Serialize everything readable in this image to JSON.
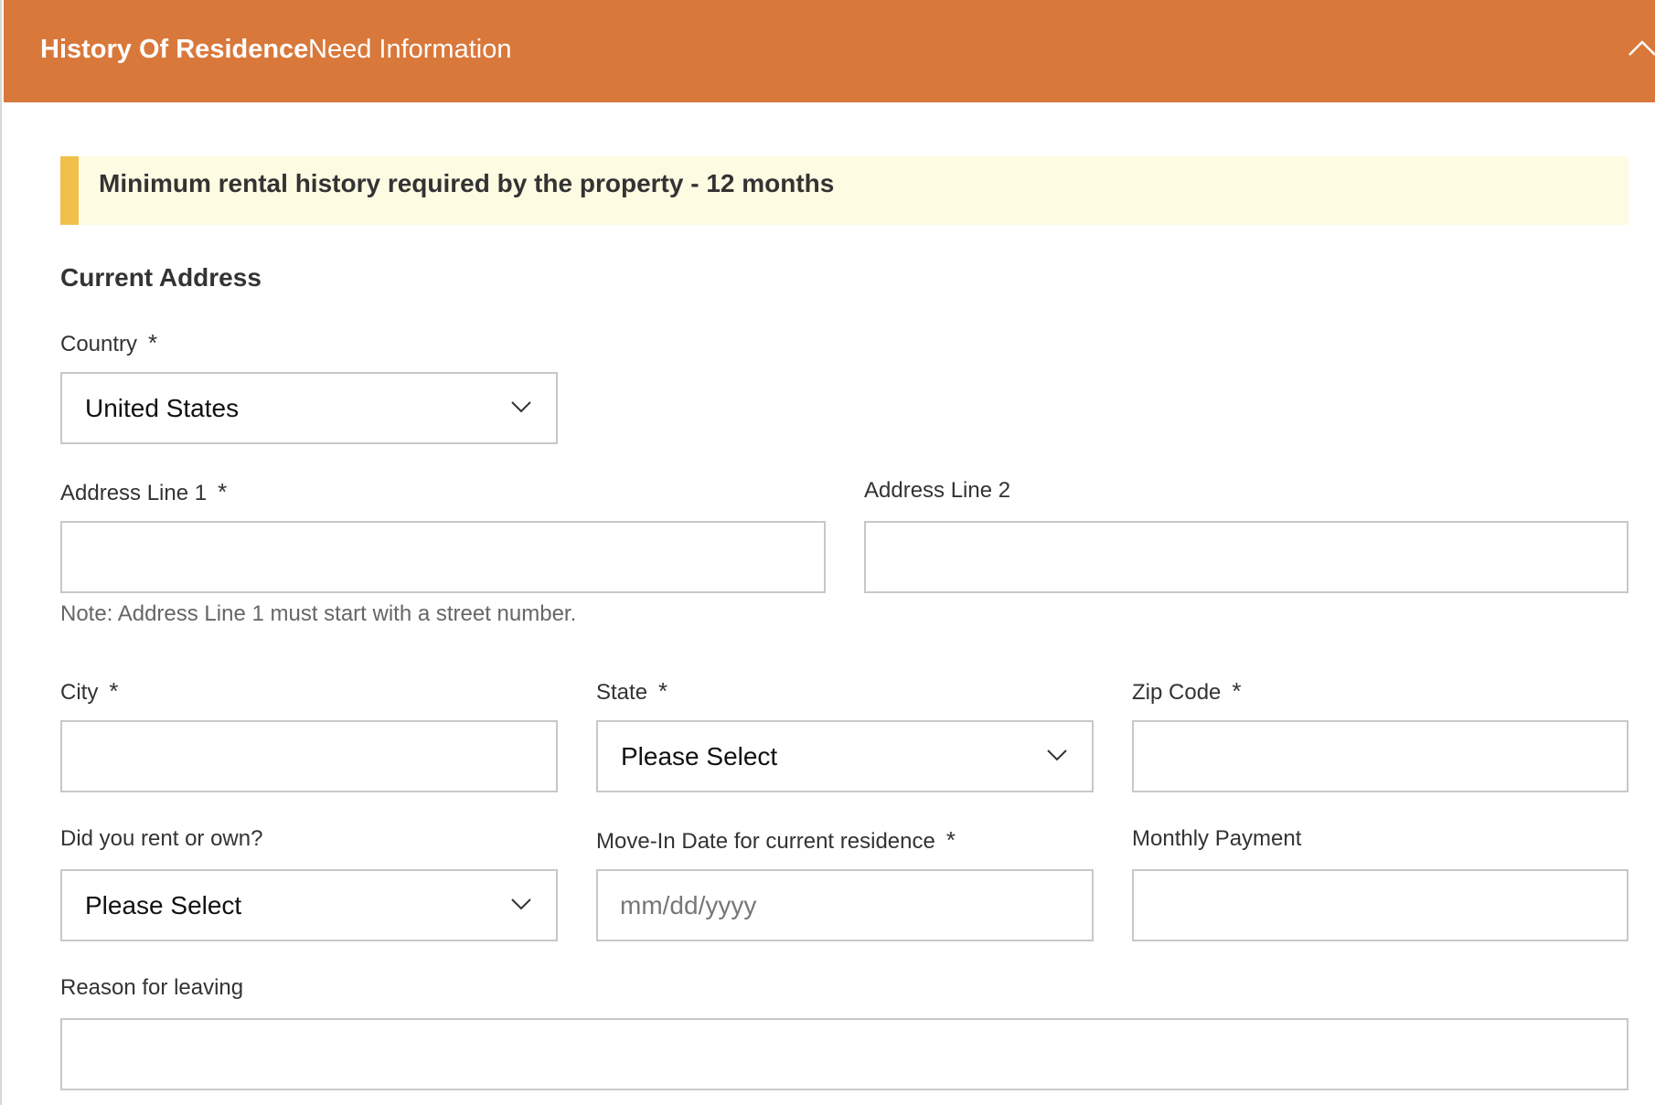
{
  "header": {
    "title": "History Of Residence",
    "status": "Need Information",
    "toggle_icon": "chevron-up-icon",
    "bg_color": "#d9783b"
  },
  "notice": {
    "text": "Minimum rental history required by the property - 12 months",
    "accent_color": "#f0c04a",
    "bg_color": "#fefbe3"
  },
  "section": {
    "title": "Current Address"
  },
  "required_marker": "*",
  "fields": {
    "country": {
      "label": "Country",
      "value": "United States"
    },
    "address1": {
      "label": "Address Line 1",
      "value": "",
      "note": "Note: Address Line 1 must start with a street number."
    },
    "address2": {
      "label": "Address Line 2",
      "value": ""
    },
    "city": {
      "label": "City",
      "value": ""
    },
    "state": {
      "label": "State",
      "value": "Please Select"
    },
    "zip": {
      "label": "Zip Code",
      "value": ""
    },
    "rent_own": {
      "label": "Did you rent or own?",
      "value": "Please Select"
    },
    "move_in": {
      "label": "Move-In Date for current residence",
      "value": "",
      "placeholder": "mm/dd/yyyy"
    },
    "monthly_payment": {
      "label": "Monthly Payment",
      "value": ""
    },
    "reason": {
      "label": "Reason for leaving",
      "value": ""
    }
  }
}
